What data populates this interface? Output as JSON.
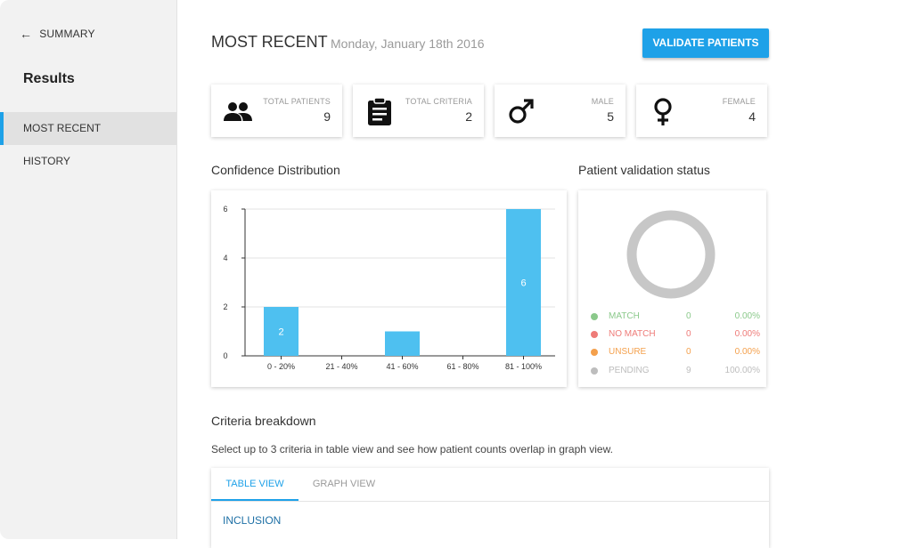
{
  "sidebar": {
    "back_label": "SUMMARY",
    "title": "Results",
    "items": [
      {
        "label": "MOST RECENT",
        "active": true
      },
      {
        "label": "HISTORY",
        "active": false
      }
    ]
  },
  "header": {
    "title": "MOST RECENT",
    "date": "Monday, January 18th 2016",
    "validate_label": "VALIDATE PATIENTS"
  },
  "stats": [
    {
      "label": "TOTAL PATIENTS",
      "value": "9",
      "icon": "people-icon"
    },
    {
      "label": "TOTAL CRITERIA",
      "value": "2",
      "icon": "clipboard-icon"
    },
    {
      "label": "MALE",
      "value": "5",
      "icon": "male-icon"
    },
    {
      "label": "FEMALE",
      "value": "4",
      "icon": "female-icon"
    }
  ],
  "confidence": {
    "title": "Confidence Distribution"
  },
  "chart_data": {
    "type": "bar",
    "categories": [
      "0 - 20%",
      "21 - 40%",
      "41 - 60%",
      "61 - 80%",
      "81 - 100%"
    ],
    "values": [
      2,
      0,
      1,
      0,
      6
    ],
    "data_labels": [
      "2",
      "",
      "",
      "",
      "6"
    ],
    "yticks": [
      "0",
      "2",
      "4",
      "6"
    ],
    "ylim": [
      0,
      6
    ],
    "title": "",
    "xlabel": "",
    "ylabel": "",
    "grid": true,
    "bar_color": "#4ec0f0"
  },
  "validation": {
    "title": "Patient validation status",
    "rows": [
      {
        "name": "MATCH",
        "count": "0",
        "pct": "0.00%",
        "color": "#8bc98b"
      },
      {
        "name": "NO MATCH",
        "count": "0",
        "pct": "0.00%",
        "color": "#ee7b78"
      },
      {
        "name": "UNSURE",
        "count": "0",
        "pct": "0.00%",
        "color": "#f4a04c"
      },
      {
        "name": "PENDING",
        "count": "9",
        "pct": "100.00%",
        "color": "#bdbdbd"
      }
    ],
    "donut_color": "#c7c7c7"
  },
  "criteria": {
    "title": "Criteria breakdown",
    "description": "Select up to 3 criteria in table view and see how patient counts overlap in graph view.",
    "tabs": [
      {
        "label": "TABLE VIEW",
        "active": true
      },
      {
        "label": "GRAPH VIEW",
        "active": false
      }
    ],
    "section_label": "INCLUSION"
  }
}
